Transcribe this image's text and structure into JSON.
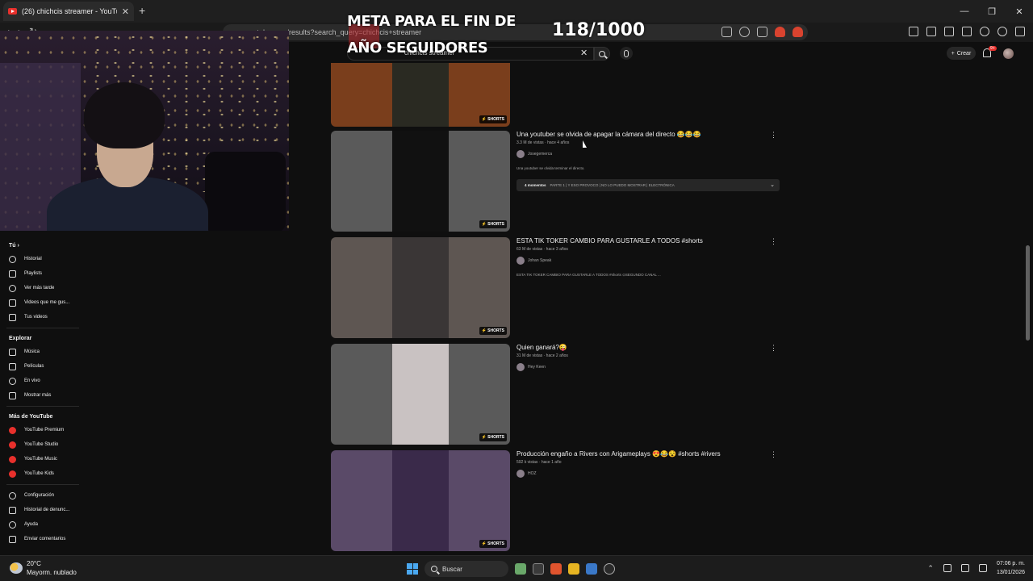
{
  "browser": {
    "tab_title": "(26) chichcis streamer - YouTube",
    "tab_close": "✕",
    "new_tab": "+",
    "url": "youtube.com/results?search_query=chichcis+streamer",
    "nav": {
      "back": "‹",
      "forward": "›",
      "reload": "↻"
    },
    "window_controls": {
      "minimize": "—",
      "maximize": "❐",
      "close": "✕"
    }
  },
  "overlay": {
    "goal_line1": "META PARA EL FIN DE",
    "goal_line2": "AÑO SEGUIDORES",
    "counter": "118/1000"
  },
  "youtube": {
    "search_value": "chichcis streamer",
    "search_clear": "✕",
    "create_label": "Crear",
    "create_plus": "+",
    "notification_count": "9+"
  },
  "sidebar": {
    "you_label": "Tú",
    "you_chevron": "›",
    "you_items": [
      {
        "label": "Historial",
        "icon": "history-icon"
      },
      {
        "label": "Playlists",
        "icon": "playlist-icon"
      },
      {
        "label": "Ver más tarde",
        "icon": "clock-icon"
      },
      {
        "label": "Videos que me gus...",
        "icon": "like-icon"
      },
      {
        "label": "Tus videos",
        "icon": "video-icon"
      }
    ],
    "explore_label": "Explorar",
    "explore_items": [
      {
        "label": "Música",
        "icon": "music-icon"
      },
      {
        "label": "Películas",
        "icon": "film-icon"
      },
      {
        "label": "En vivo",
        "icon": "live-icon"
      },
      {
        "label": "Mostrar más",
        "icon": "chevron-down-icon"
      }
    ],
    "more_label": "Más de YouTube",
    "more_items": [
      {
        "label": "YouTube Premium",
        "icon": "youtube-premium-icon"
      },
      {
        "label": "YouTube Studio",
        "icon": "youtube-studio-icon"
      },
      {
        "label": "YouTube Music",
        "icon": "youtube-music-icon"
      },
      {
        "label": "YouTube Kids",
        "icon": "youtube-kids-icon"
      }
    ],
    "settings_items": [
      {
        "label": "Configuración",
        "icon": "gear-icon"
      },
      {
        "label": "Historial de denunc...",
        "icon": "flag-icon"
      },
      {
        "label": "Ayuda",
        "icon": "help-icon"
      },
      {
        "label": "Enviar comentarios",
        "icon": "feedback-icon"
      }
    ]
  },
  "results": [
    {
      "title": "",
      "meta": "",
      "channel": "",
      "badge": "SHORTS",
      "thumb_color": "#7a3e1c",
      "inner_color": "#2a2a22"
    },
    {
      "title": "Una youtuber se olvida de apagar la cámara del directo 😂😂😂",
      "meta": "3.3 M de vistas · hace 4 años",
      "channel": "Josegemerca",
      "desc": "Una youtuber se olvida terminar el directo.",
      "moments_bold": "4 momentos",
      "moments_text": "PARTE 1 | Y ESO PROVOCO | NO LO PUEDO MOSTRAR | ELECTRÓNICA",
      "moments_chevron": "⌄",
      "badge": "SHORTS",
      "thumb_color": "#5a5a5a",
      "inner_color": "#111111"
    },
    {
      "title": "ESTA TIK TOKER CAMBIO PARA GUSTARLE A TODOS #shorts",
      "meta": "63 M de vistas · hace 3 años",
      "channel": "Johan Speak",
      "desc": "ESTA TIK TOKER CAMBIO PARA GUSTARLE A TODOS #shorts ⊙SEGUNDO CANAL ...",
      "badge": "SHORTS",
      "thumb_color": "#5e5652",
      "inner_color": "#3a3636"
    },
    {
      "title": "Quien ganará?😜",
      "meta": "31 M de vistas · hace 2 años",
      "channel": "Hey Keen",
      "badge": "SHORTS",
      "thumb_color": "#5a5a5a",
      "inner_color": "#c9c2c2"
    },
    {
      "title": "Producción engaño a Rivers con Arigameplays 😍😂😵 #shorts #rivers",
      "meta": "592 k vistas · hace 1 año",
      "channel": "HOZ",
      "badge": "SHORTS",
      "thumb_color": "#5a4a68",
      "inner_color": "#3a2a4a"
    }
  ],
  "taskbar": {
    "temperature": "20°C",
    "weather": "Mayorm. nublado",
    "search_placeholder": "Buscar",
    "time": "07:06 p. m.",
    "date": "13/01/2026"
  }
}
